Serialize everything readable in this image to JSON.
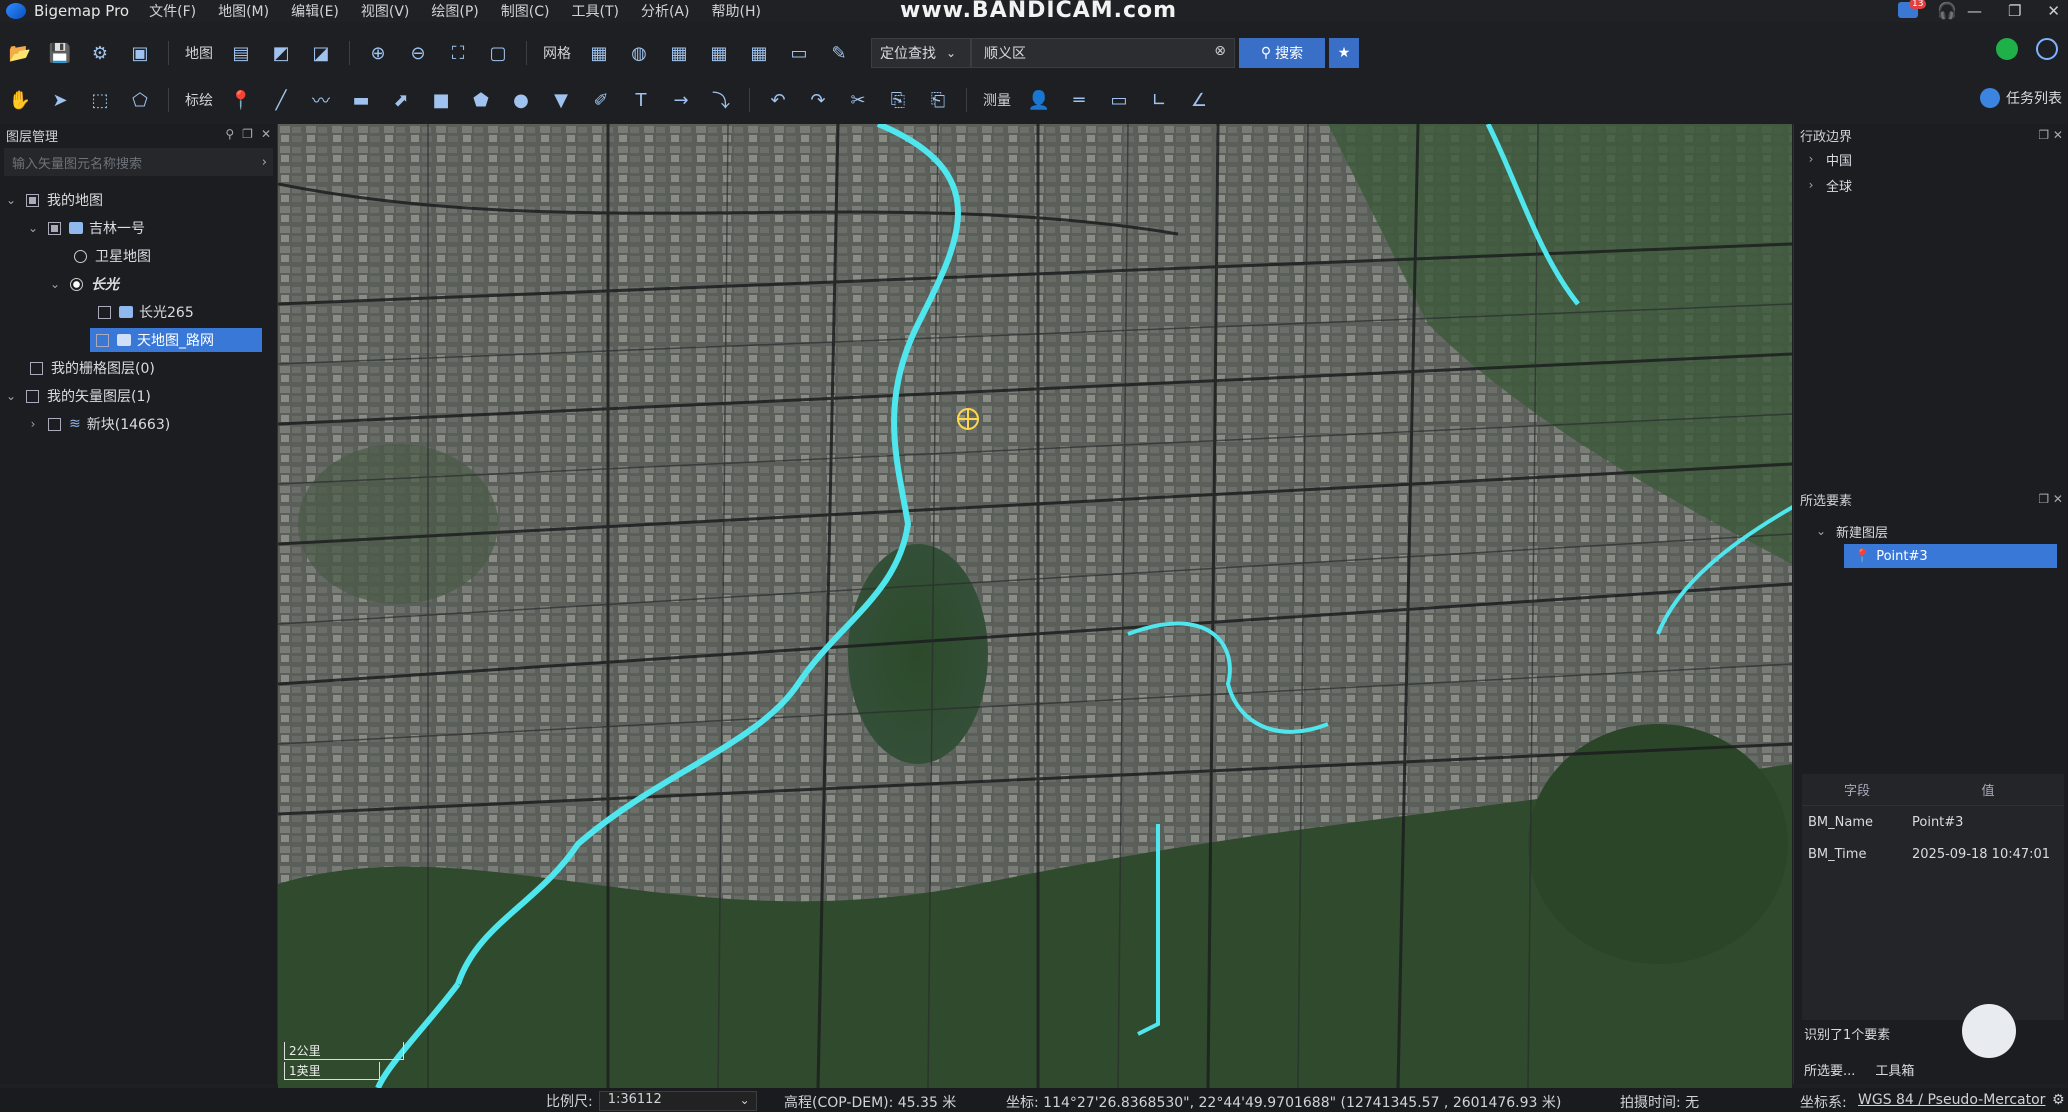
{
  "app": {
    "title": "Bigemap Pro"
  },
  "watermark": "www.BANDICAM.com",
  "notify_count": "13",
  "menu": [
    "文件(F)",
    "地图(M)",
    "编辑(E)",
    "视图(V)",
    "绘图(P)",
    "制图(C)",
    "工具(T)",
    "分析(A)",
    "帮助(H)"
  ],
  "toolbar1": {
    "map_label": "地图",
    "grid_label": "网格",
    "locate_mode": "定位查找",
    "locate_value": "顺义区",
    "search_label": "搜索"
  },
  "toolbar2": {
    "draw_label": "标绘",
    "measure_label": "测量",
    "tasklist_label": "任务列表"
  },
  "layers_panel": {
    "title": "图层管理",
    "search_placeholder": "输入矢量图元名称搜索",
    "tree": {
      "my_map": "我的地图",
      "jilin": "吉林一号",
      "satellite": "卫星地图",
      "changguang": "长光",
      "changguang265": "长光265",
      "tianditu_road": "天地图_路网",
      "raster": "我的栅格图层(0)",
      "vector": "我的矢量图层(1)",
      "newblock": "新块(14663)"
    }
  },
  "admin_panel": {
    "title": "行政边界",
    "items": [
      "中国",
      "全球"
    ]
  },
  "selected_panel": {
    "title": "所选要素",
    "layer": "新建图层",
    "feature": "Point#3",
    "col_field": "字段",
    "col_value": "值",
    "rows": [
      {
        "field": "BM_Name",
        "value": "Point#3"
      },
      {
        "field": "BM_Time",
        "value": "2025-09-18 10:47:01"
      }
    ],
    "identified": "识别了1个要素",
    "tab1": "所选要...",
    "tab2": "工具箱"
  },
  "map": {
    "scale_km": "2公里",
    "scale_mi": "1英里"
  },
  "status": {
    "scale_label": "比例尺:",
    "scale_value": "1:36112",
    "elevation": "高程(COP-DEM): 45.35 米",
    "coords": "坐标: 114°27'26.8368530\", 22°44'49.9701688\"  (12741345.57 , 2601476.93 米)",
    "capture_time": "拍摄时间: 无",
    "crs_label": "坐标系:",
    "crs_value": "WGS 84 / Pseudo-Mercator"
  },
  "colors": {
    "accent": "#3a78d8",
    "river": "#4fe6ee"
  }
}
